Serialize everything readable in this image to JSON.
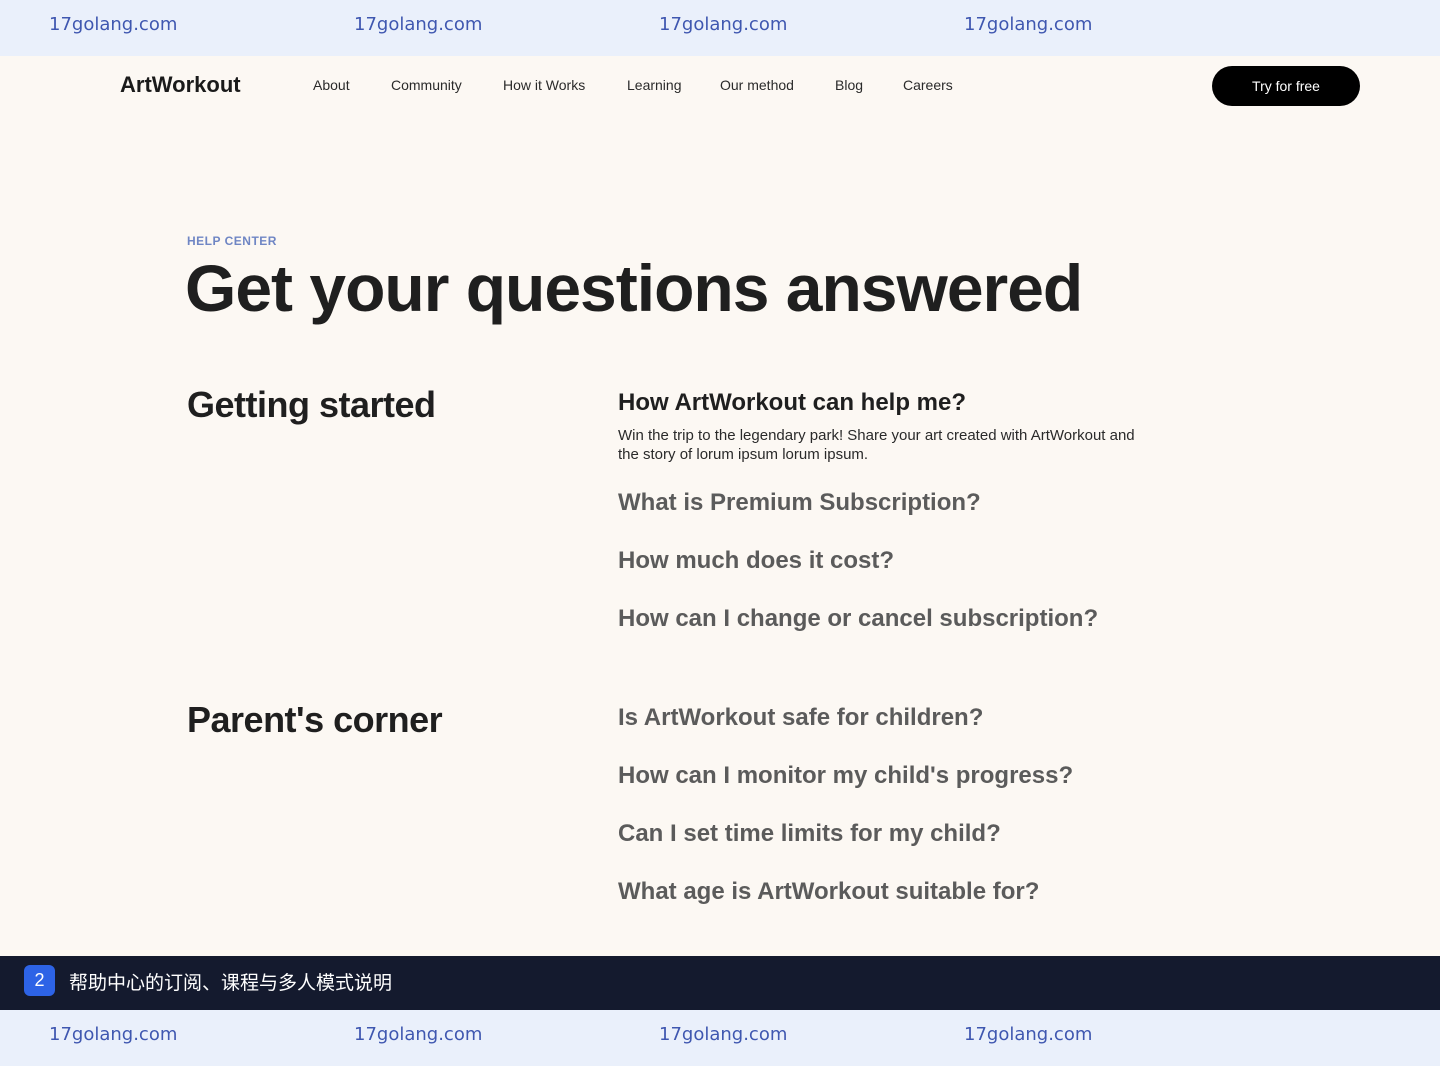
{
  "watermark": {
    "text": "17golang.com"
  },
  "header": {
    "logo": "ArtWorkout",
    "nav": [
      "About",
      "Community",
      "How it Works",
      "Learning",
      "Our method",
      "Blog",
      "Careers"
    ],
    "cta_label": "Try for free"
  },
  "hero": {
    "eyebrow": "HELP CENTER",
    "title": "Get your questions answered"
  },
  "sections": [
    {
      "title": "Getting started",
      "questions": [
        {
          "q": "How ArtWorkout can help me?",
          "a": "Win the trip to the legendary park! Share your art created with ArtWorkout and the story of lorum ipsum lorum ipsum.",
          "expanded": true
        },
        {
          "q": "What is Premium Subscription?",
          "expanded": false
        },
        {
          "q": "How much does it cost?",
          "expanded": false
        },
        {
          "q": "How can I change or cancel subscription?",
          "expanded": false
        }
      ]
    },
    {
      "title": "Parent's corner",
      "questions": [
        {
          "q": "Is ArtWorkout safe for children?",
          "expanded": false
        },
        {
          "q": "How can I monitor my child's progress?",
          "expanded": false
        },
        {
          "q": "Can I set time limits for my child?",
          "expanded": false
        },
        {
          "q": "What age is ArtWorkout suitable for?",
          "expanded": false
        }
      ]
    }
  ],
  "caption": {
    "badge": "2",
    "text": "帮助中心的订阅、课程与多人模式说明"
  },
  "colors": {
    "background": "#fcf8f3",
    "watermark_band": "#eaf0fb",
    "watermark_text": "#3f57b0",
    "eyebrow": "#6f86c4",
    "cta_bg": "#000000",
    "caption_bg": "#141a2e",
    "caption_badge": "#2d63e6"
  }
}
